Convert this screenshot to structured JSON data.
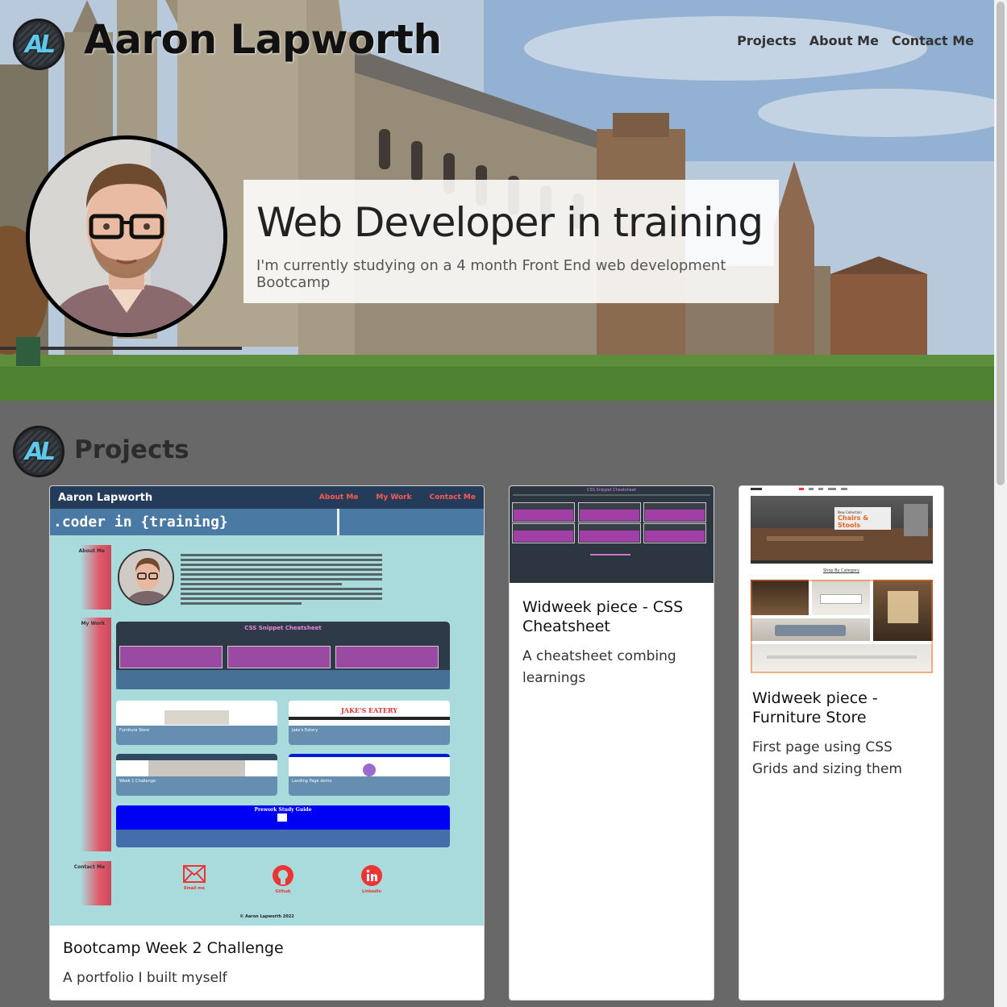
{
  "header": {
    "logo_text": "AL",
    "site_title": "Aaron Lapworth",
    "nav": [
      "Projects",
      "About Me",
      "Contact Me"
    ]
  },
  "hero": {
    "heading": "Web Developer in training",
    "subheading": "I'm currently studying on a 4 month Front End web development Bootcamp"
  },
  "projects": {
    "title": "Projects",
    "logo_text": "AL",
    "cards": [
      {
        "title": "Bootcamp Week 2 Challenge",
        "text": "A portfolio I built myself",
        "thumbnail": {
          "brand": "Aaron Lapworth",
          "nav": [
            "About Me",
            "My Work",
            "Contact Me"
          ],
          "banner": ".coder in {training}",
          "side_labels": [
            "About Me",
            "My Work",
            "Contact Me"
          ],
          "cheatsheet_title": "CSS Snippet Cheatsheet",
          "mini_labels": [
            "Furniture Store",
            "Jake's Eatery",
            "Week 1 Challenge",
            "Landing Page demo"
          ],
          "jakes_logo": "JAKE'S EATERY",
          "prework_title": "Prework Study Guide",
          "contact_icons": [
            "Email me",
            "Github",
            "LinkedIn"
          ],
          "copyright": "© Aaron Lapworth 2022"
        }
      },
      {
        "title": "Widweek piece - CSS Cheatsheet",
        "text": "A cheatsheet combing learnings",
        "thumbnail": {
          "title": "CSS Snippet Cheatsheet"
        }
      },
      {
        "title": "Widweek piece - Furniture Store",
        "text": "First page using CSS Grids and sizing them",
        "thumbnail": {
          "headline": "Chairs & Stools",
          "shop_label": "Shop By Category"
        }
      }
    ]
  },
  "colors": {
    "page_bg": "#686868",
    "hero_box_bg": "#ffffff",
    "thumb_nav": "#243b5a",
    "thumb_accent": "#ff5a4e",
    "logo_accent": "#5fc7ea"
  }
}
